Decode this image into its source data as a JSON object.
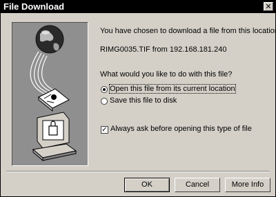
{
  "window": {
    "title": "File Download",
    "close_glyph": "✕"
  },
  "message": "You have chosen to download a file from this location.",
  "file_source": "RIMG0035.TIF from 192.168.181.240",
  "question": "What would you like to do with this file?",
  "options": [
    {
      "label": "Open this file from its current location",
      "selected": true
    },
    {
      "label": "Save this file to disk",
      "selected": false
    }
  ],
  "always_ask": {
    "label": "Always ask before opening this type of file",
    "checked": true,
    "check_glyph": "✓"
  },
  "buttons": {
    "ok": "OK",
    "cancel": "Cancel",
    "more_info": "More Info"
  },
  "icons": [
    "globe-icon",
    "document-icon",
    "computer-icon"
  ]
}
